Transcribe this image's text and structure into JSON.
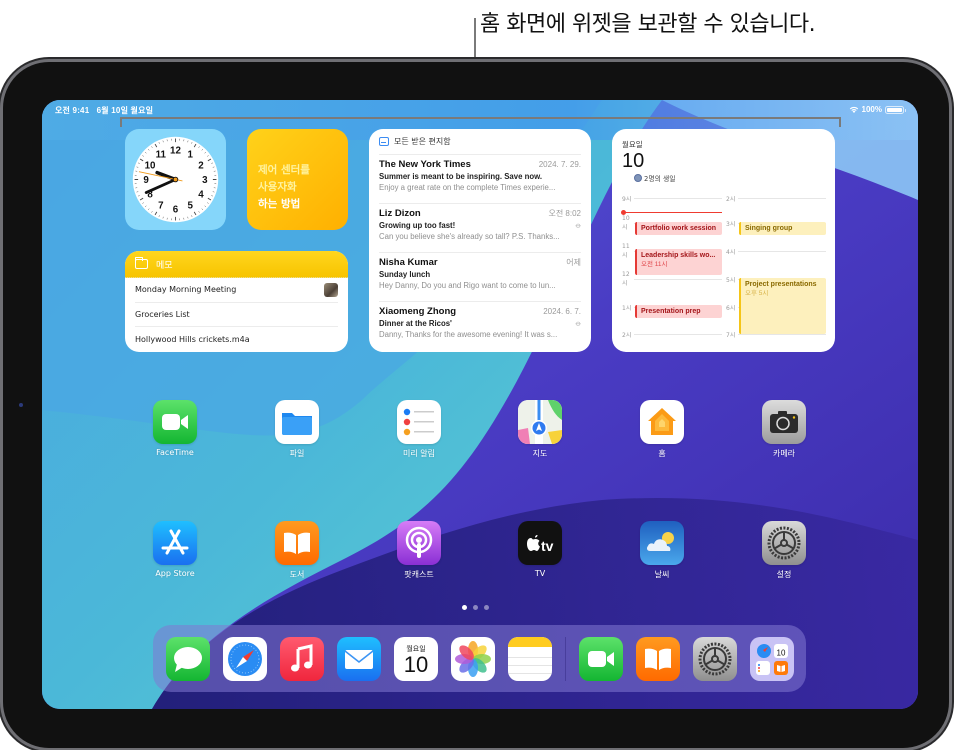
{
  "callout": {
    "text": "홈 화면에 위젯을 보관할 수 있습니다."
  },
  "status_bar": {
    "time": "오전 9:41",
    "date": "6월 10일 월요일",
    "battery": "100%"
  },
  "widgets": {
    "clock": {
      "hour_numbers": [
        "12",
        "1",
        "2",
        "3",
        "4",
        "5",
        "6",
        "7",
        "8",
        "9",
        "10",
        "11"
      ],
      "time": "9:41"
    },
    "tips": {
      "lines": [
        "제어 센터를",
        "사용자화",
        "하는 방법"
      ]
    },
    "notes": {
      "title": "메모",
      "items": [
        {
          "title": "Monday Morning Meeting",
          "has_thumbnail": true
        },
        {
          "title": "Groceries List",
          "has_thumbnail": false
        },
        {
          "title": "Hollywood Hills crickets.m4a",
          "has_thumbnail": false
        }
      ]
    },
    "mail": {
      "mailbox": "모든 받은 편지함",
      "messages": [
        {
          "sender": "The New York Times",
          "date": "2024. 7. 29.",
          "subject": "Summer is meant to be inspiring. Save now.",
          "preview": "Enjoy a great rate on the complete Times experie...",
          "attachment": false
        },
        {
          "sender": "Liz Dizon",
          "date": "오전 8:02",
          "subject": "Growing up too fast!",
          "preview": "Can you believe she's already so tall? P.S. Thanks...",
          "attachment": true
        },
        {
          "sender": "Nisha Kumar",
          "date": "어제",
          "subject": "Sunday lunch",
          "preview": "Hey Danny, Do you and Rigo want to come to lun...",
          "attachment": false
        },
        {
          "sender": "Xiaomeng Zhong",
          "date": "2024. 6. 7.",
          "subject": "Dinner at the Ricos'",
          "preview": "Danny, Thanks for the awesome evening! It was s...",
          "attachment": true
        }
      ]
    },
    "calendar": {
      "weekday": "월요일",
      "day": "10",
      "birthday_note": "2명의 생일",
      "left_hours": [
        "9시",
        "10시",
        "11시",
        "12시",
        "1시",
        "2시"
      ],
      "right_hours": [
        "2시",
        "3시",
        "4시",
        "5시",
        "6시",
        "7시"
      ],
      "events": [
        {
          "title": "Portfolio work session",
          "time": "",
          "color": "red"
        },
        {
          "title": "Leadership skills wo...",
          "time": "오전 11시",
          "color": "red"
        },
        {
          "title": "Presentation prep",
          "time": "",
          "color": "red"
        },
        {
          "title": "Singing group",
          "time": "",
          "color": "yellow"
        },
        {
          "title": "Project presentations",
          "time": "오후 5시",
          "color": "yellow"
        }
      ]
    }
  },
  "apps": [
    {
      "name": "FaceTime",
      "icon": "facetime-icon"
    },
    {
      "name": "파일",
      "icon": "files-icon"
    },
    {
      "name": "미리 알림",
      "icon": "reminders-icon"
    },
    {
      "name": "지도",
      "icon": "maps-icon"
    },
    {
      "name": "홈",
      "icon": "home-icon"
    },
    {
      "name": "카메라",
      "icon": "camera-icon"
    },
    {
      "name": "App Store",
      "icon": "app-store-icon"
    },
    {
      "name": "도서",
      "icon": "books-icon"
    },
    {
      "name": "팟캐스트",
      "icon": "podcasts-icon"
    },
    {
      "name": "TV",
      "icon": "tv-icon"
    },
    {
      "name": "날씨",
      "icon": "weather-icon"
    },
    {
      "name": "설정",
      "icon": "settings-icon"
    }
  ],
  "page_indicator": {
    "pages": 3,
    "current": 1
  },
  "dock": {
    "apps": [
      {
        "name": "Messages",
        "icon": "messages-icon"
      },
      {
        "name": "Safari",
        "icon": "safari-icon"
      },
      {
        "name": "Music",
        "icon": "music-icon"
      },
      {
        "name": "Mail",
        "icon": "mail-icon"
      },
      {
        "name": "Calendar",
        "icon": "calendar-icon",
        "weekday": "월요일",
        "day": "10"
      },
      {
        "name": "Photos",
        "icon": "photos-icon"
      },
      {
        "name": "Notes",
        "icon": "notes-icon"
      }
    ],
    "recent_apps": [
      {
        "name": "FaceTime",
        "icon": "facetime-icon"
      },
      {
        "name": "Books",
        "icon": "books-icon"
      },
      {
        "name": "Settings",
        "icon": "settings-icon"
      },
      {
        "name": "App Library",
        "icon": "app-library-icon",
        "mini_day": "10"
      }
    ]
  },
  "colors": {
    "tips_yellow": "#ffc20e",
    "notes_yellow": "#f9cc0b",
    "event_red": "#e53935",
    "event_yellow": "#f5c518",
    "accent_blue": "#3b8cf3"
  }
}
